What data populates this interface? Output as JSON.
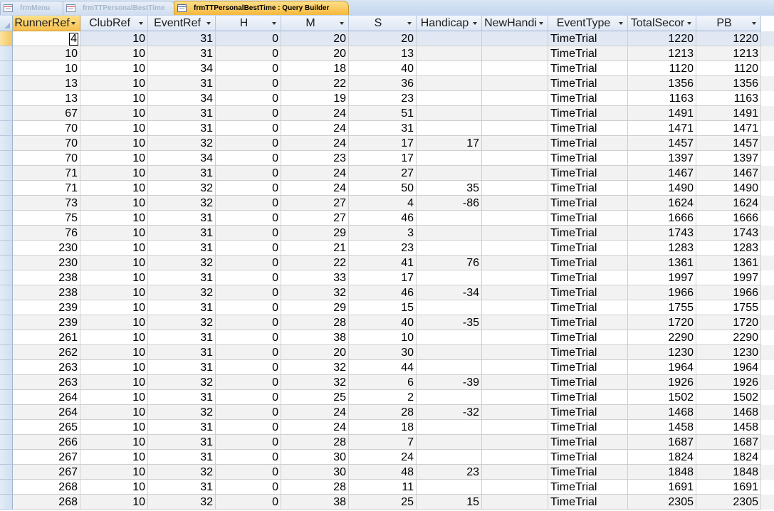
{
  "tabs": [
    {
      "label": "frmMenu",
      "active": false
    },
    {
      "label": "frmTTPersonalBestTime",
      "active": false
    },
    {
      "label": "frmTTPersonalBestTime : Query Builder",
      "active": true
    }
  ],
  "columns": [
    "RunnerRef",
    "ClubRef",
    "EventRef",
    "H",
    "M",
    "S",
    "Handicap",
    "NewHandi",
    "EventType",
    "TotalSecor",
    "PB"
  ],
  "rows": [
    [
      "4",
      "10",
      "31",
      "0",
      "20",
      "20",
      "",
      "",
      "TimeTrial",
      "1220",
      "1220"
    ],
    [
      "10",
      "10",
      "31",
      "0",
      "20",
      "13",
      "",
      "",
      "TimeTrial",
      "1213",
      "1213"
    ],
    [
      "10",
      "10",
      "34",
      "0",
      "18",
      "40",
      "",
      "",
      "TimeTrial",
      "1120",
      "1120"
    ],
    [
      "13",
      "10",
      "31",
      "0",
      "22",
      "36",
      "",
      "",
      "TimeTrial",
      "1356",
      "1356"
    ],
    [
      "13",
      "10",
      "34",
      "0",
      "19",
      "23",
      "",
      "",
      "TimeTrial",
      "1163",
      "1163"
    ],
    [
      "67",
      "10",
      "31",
      "0",
      "24",
      "51",
      "",
      "",
      "TimeTrial",
      "1491",
      "1491"
    ],
    [
      "70",
      "10",
      "31",
      "0",
      "24",
      "31",
      "",
      "",
      "TimeTrial",
      "1471",
      "1471"
    ],
    [
      "70",
      "10",
      "32",
      "0",
      "24",
      "17",
      "17",
      "",
      "TimeTrial",
      "1457",
      "1457"
    ],
    [
      "70",
      "10",
      "34",
      "0",
      "23",
      "17",
      "",
      "",
      "TimeTrial",
      "1397",
      "1397"
    ],
    [
      "71",
      "10",
      "31",
      "0",
      "24",
      "27",
      "",
      "",
      "TimeTrial",
      "1467",
      "1467"
    ],
    [
      "71",
      "10",
      "32",
      "0",
      "24",
      "50",
      "35",
      "",
      "TimeTrial",
      "1490",
      "1490"
    ],
    [
      "73",
      "10",
      "32",
      "0",
      "27",
      "4",
      "-86",
      "",
      "TimeTrial",
      "1624",
      "1624"
    ],
    [
      "75",
      "10",
      "31",
      "0",
      "27",
      "46",
      "",
      "",
      "TimeTrial",
      "1666",
      "1666"
    ],
    [
      "76",
      "10",
      "31",
      "0",
      "29",
      "3",
      "",
      "",
      "TimeTrial",
      "1743",
      "1743"
    ],
    [
      "230",
      "10",
      "31",
      "0",
      "21",
      "23",
      "",
      "",
      "TimeTrial",
      "1283",
      "1283"
    ],
    [
      "230",
      "10",
      "32",
      "0",
      "22",
      "41",
      "76",
      "",
      "TimeTrial",
      "1361",
      "1361"
    ],
    [
      "238",
      "10",
      "31",
      "0",
      "33",
      "17",
      "",
      "",
      "TimeTrial",
      "1997",
      "1997"
    ],
    [
      "238",
      "10",
      "32",
      "0",
      "32",
      "46",
      "-34",
      "",
      "TimeTrial",
      "1966",
      "1966"
    ],
    [
      "239",
      "10",
      "31",
      "0",
      "29",
      "15",
      "",
      "",
      "TimeTrial",
      "1755",
      "1755"
    ],
    [
      "239",
      "10",
      "32",
      "0",
      "28",
      "40",
      "-35",
      "",
      "TimeTrial",
      "1720",
      "1720"
    ],
    [
      "261",
      "10",
      "31",
      "0",
      "38",
      "10",
      "",
      "",
      "TimeTrial",
      "2290",
      "2290"
    ],
    [
      "262",
      "10",
      "31",
      "0",
      "20",
      "30",
      "",
      "",
      "TimeTrial",
      "1230",
      "1230"
    ],
    [
      "263",
      "10",
      "31",
      "0",
      "32",
      "44",
      "",
      "",
      "TimeTrial",
      "1964",
      "1964"
    ],
    [
      "263",
      "10",
      "32",
      "0",
      "32",
      "6",
      "-39",
      "",
      "TimeTrial",
      "1926",
      "1926"
    ],
    [
      "264",
      "10",
      "31",
      "0",
      "25",
      "2",
      "",
      "",
      "TimeTrial",
      "1502",
      "1502"
    ],
    [
      "264",
      "10",
      "32",
      "0",
      "24",
      "28",
      "-32",
      "",
      "TimeTrial",
      "1468",
      "1468"
    ],
    [
      "265",
      "10",
      "31",
      "0",
      "24",
      "18",
      "",
      "",
      "TimeTrial",
      "1458",
      "1458"
    ],
    [
      "266",
      "10",
      "31",
      "0",
      "28",
      "7",
      "",
      "",
      "TimeTrial",
      "1687",
      "1687"
    ],
    [
      "267",
      "10",
      "31",
      "0",
      "30",
      "24",
      "",
      "",
      "TimeTrial",
      "1824",
      "1824"
    ],
    [
      "267",
      "10",
      "32",
      "0",
      "30",
      "48",
      "23",
      "",
      "TimeTrial",
      "1848",
      "1848"
    ],
    [
      "268",
      "10",
      "31",
      "0",
      "28",
      "11",
      "",
      "",
      "TimeTrial",
      "1691",
      "1691"
    ],
    [
      "268",
      "10",
      "32",
      "0",
      "38",
      "25",
      "15",
      "",
      "TimeTrial",
      "2305",
      "2305"
    ]
  ],
  "current_row": 0,
  "colors": {
    "accent": "#f7c04f",
    "header": "#dde7f4",
    "alt_row": "#f2f2f2"
  }
}
